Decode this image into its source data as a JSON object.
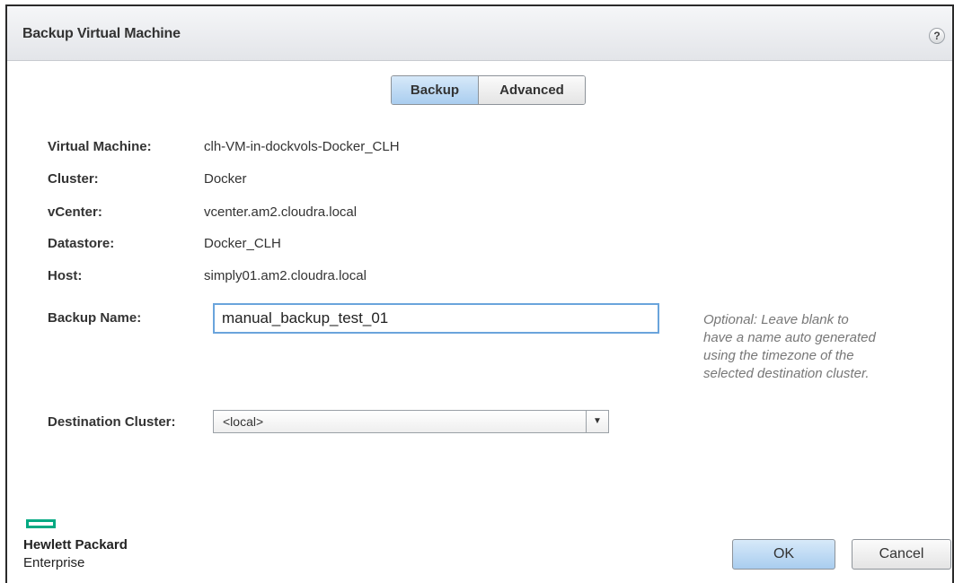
{
  "dialog": {
    "title": "Backup Virtual Machine",
    "help_glyph": "?"
  },
  "tabs": [
    {
      "label": "Backup",
      "active": true
    },
    {
      "label": "Advanced",
      "active": false
    }
  ],
  "details": [
    {
      "label": "Virtual Machine:",
      "value": "clh-VM-in-dockvols-Docker_CLH"
    },
    {
      "label": "Cluster:",
      "value": "Docker"
    },
    {
      "label": "vCenter:",
      "value": "vcenter.am2.cloudra.local"
    },
    {
      "label": "Datastore:",
      "value": "Docker_CLH"
    },
    {
      "label": "Host:",
      "value": "simply01.am2.cloudra.local"
    }
  ],
  "backup_name": {
    "label": "Backup Name:",
    "value": "manual_backup_test_01",
    "hint_lines": [
      "Optional: Leave blank to",
      "have a name auto generated",
      "using the timezone of the",
      "selected destination cluster."
    ]
  },
  "destination_cluster": {
    "label": "Destination Cluster:",
    "selected": "<local>"
  },
  "branding": {
    "line1": "Hewlett Packard",
    "line2": "Enterprise",
    "accent_color": "#01a982"
  },
  "buttons": {
    "ok_label": "OK",
    "cancel_label": "Cancel"
  }
}
